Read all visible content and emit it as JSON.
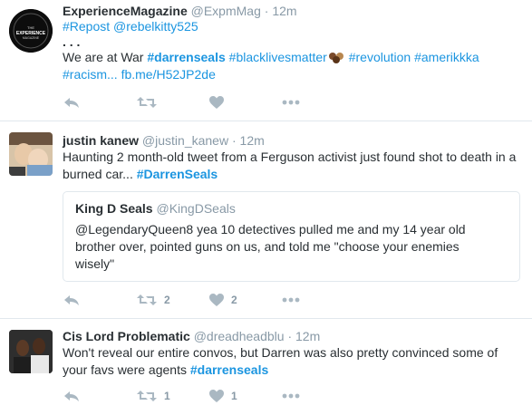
{
  "tweets": [
    {
      "name": "ExperienceMagazine",
      "handle": "@ExpmMag",
      "dot": "·",
      "time": "12m",
      "line1": "#Repost @rebelkitty525",
      "line2": ". . .",
      "text_prefix": "We are at War ",
      "hashtag_bold": "#darrenseals",
      "hashtag_blm": "#blacklivesmatter",
      "hashtag_rev": "#revolution",
      "hashtag_am": "#amerikkka",
      "hashtag_racism": "#racism...",
      "link": "fb.me/H52JP2de",
      "avatar_text": "EXPERIENCE MAGAZINE"
    },
    {
      "name": "justin kanew",
      "handle": "@justin_kanew",
      "dot": "·",
      "time": "12m",
      "text": "Haunting 2 month-old tweet from a Ferguson activist just found shot to death in a burned car... ",
      "hashtag": "#DarrenSeals",
      "quote": {
        "name": "King D Seals",
        "handle": "@KingDSeals",
        "text": "@LegendaryQueen8 yea 10 detectives pulled me and my 14 year old brother over, pointed guns on us, and told me \"choose your enemies wisely\""
      },
      "retweet_count": "2",
      "like_count": "2"
    },
    {
      "name": "Cis Lord Problematic",
      "handle": "@dreadheadblu",
      "dot": "·",
      "time": "12m",
      "text": "Won't reveal our entire convos, but Darren was also pretty convinced some of your favs were agents ",
      "hashtag": "#darrenseals",
      "retweet_count": "1",
      "like_count": "1"
    }
  ],
  "icons": [
    "reply-icon",
    "retweet-icon",
    "like-icon",
    "more-icon"
  ],
  "colors": {
    "link": "#1b95e0",
    "muted": "#8899a6",
    "text": "#292f33",
    "border": "#e1e8ed"
  }
}
